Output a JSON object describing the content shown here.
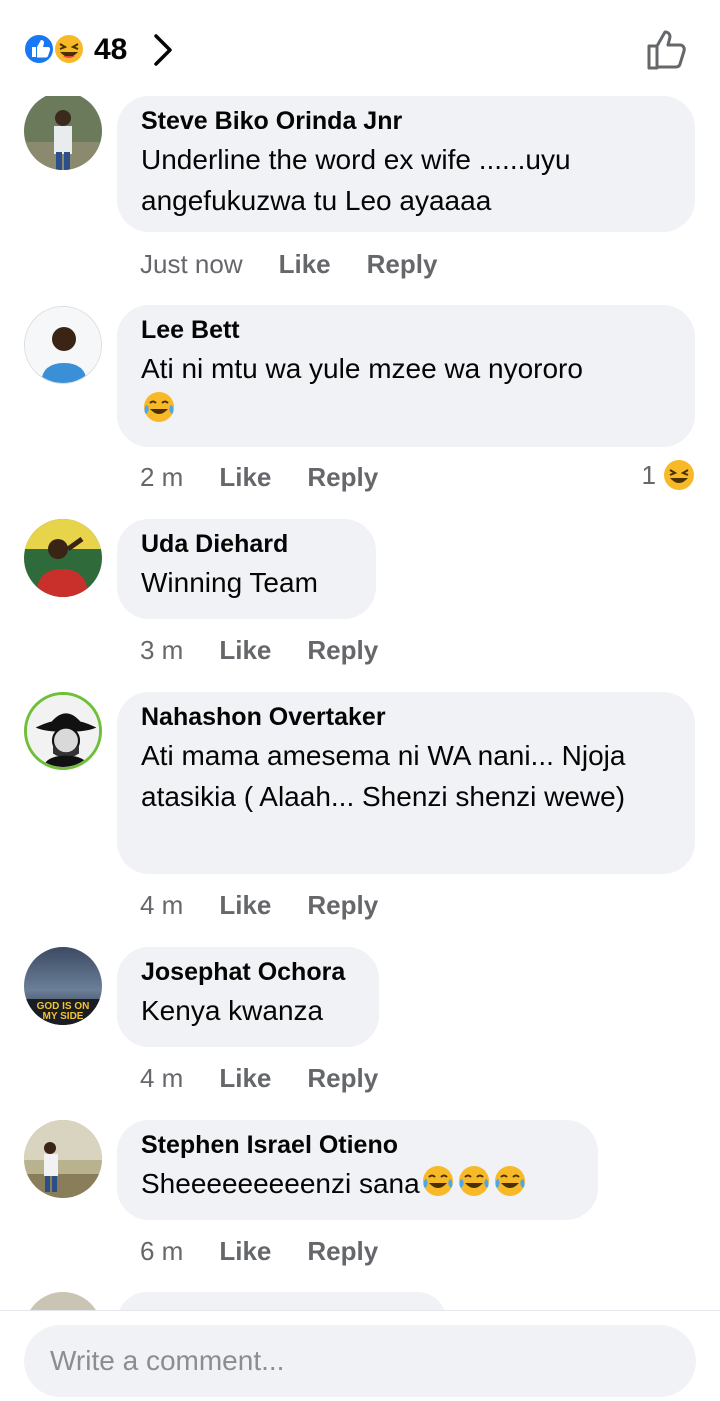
{
  "header": {
    "reaction_count": "48",
    "reaction_icons": [
      "like-icon",
      "haha-icon"
    ]
  },
  "comments": [
    {
      "name": "Steve Biko Orinda Jnr",
      "text": "Underline the word ex wife ......uyu angefukuzwa tu Leo ayaaaa",
      "time": "Just now",
      "like": "Like",
      "reply": "Reply"
    },
    {
      "name": "Lee Bett",
      "text": "Ati ni mtu wa yule mzee wa nyororo",
      "time": "2 m",
      "like": "Like",
      "reply": "Reply",
      "reactions": "1"
    },
    {
      "name": "Uda Diehard",
      "text": "Winning Team",
      "time": "3 m",
      "like": "Like",
      "reply": "Reply"
    },
    {
      "name": "Nahashon Overtaker",
      "text": "Ati mama amesema ni WA nani... Njoja atasikia ( Alaah... Shenzi shenzi wewe)",
      "time": "4 m",
      "like": "Like",
      "reply": "Reply"
    },
    {
      "name": "Josephat Ochora",
      "text": "Kenya kwanza",
      "time": "4 m",
      "like": "Like",
      "reply": "Reply",
      "avatar_text": "GOD IS ON MY SIDE"
    },
    {
      "name": "Stephen Israel Otieno",
      "text": "Sheeeeeeeeenzi sana",
      "time": "6 m",
      "like": "Like",
      "reply": "Reply"
    }
  ],
  "composer": {
    "placeholder": "Write a comment..."
  },
  "colors": {
    "like_blue": "#1877f2",
    "haha_yellow": "#f7b928",
    "bubble_gray": "#f0f2f5",
    "meta_gray": "#65676b"
  }
}
